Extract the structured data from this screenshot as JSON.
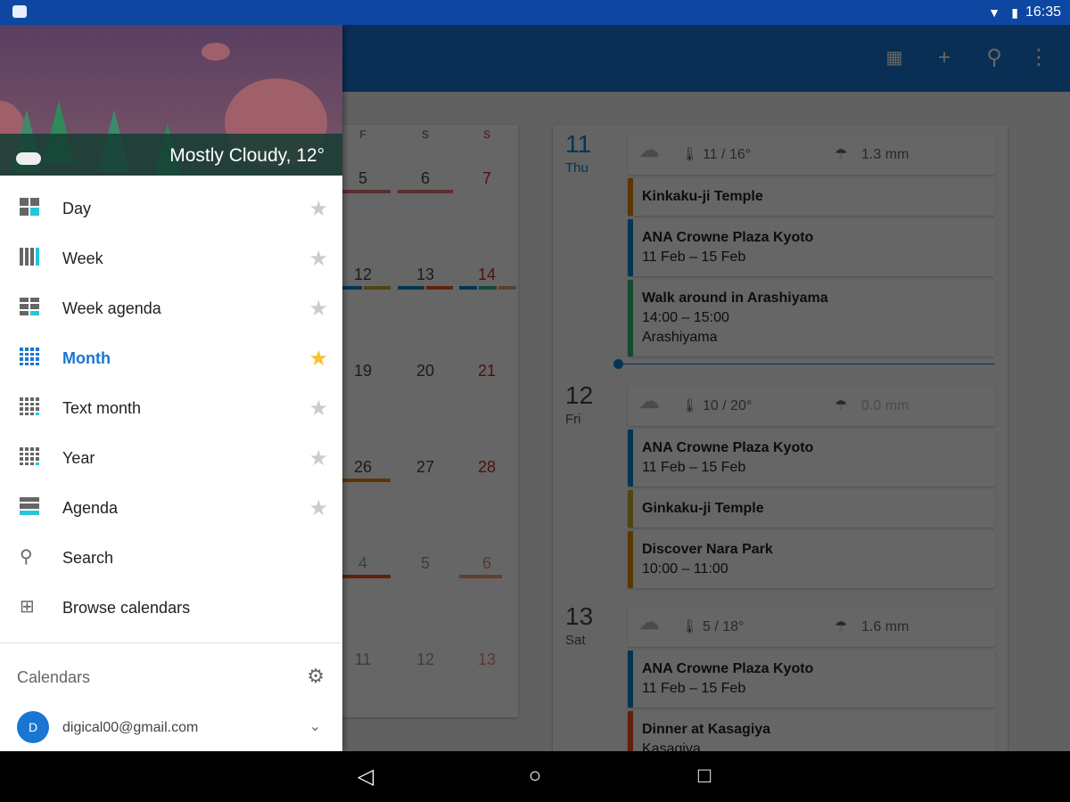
{
  "status": {
    "time": "16:35",
    "icons": [
      "android-icon",
      "wifi-icon",
      "battery-charging-icon"
    ]
  },
  "appbar": {
    "actions": [
      "today-calendar-icon",
      "add-icon",
      "search-icon",
      "more-vert-icon"
    ]
  },
  "month": {
    "headers": [
      "F",
      "S",
      "S"
    ],
    "rows": [
      [
        "5",
        "6",
        "7"
      ],
      [
        "12",
        "13",
        "14"
      ],
      [
        "19",
        "20",
        "21"
      ],
      [
        "26",
        "27",
        "28"
      ],
      [
        "4",
        "5",
        "6"
      ],
      [
        "11",
        "12",
        "13"
      ]
    ]
  },
  "agenda": {
    "days": [
      {
        "num": "11",
        "name": "Thu",
        "today": true,
        "weather": {
          "icon": "rain-icon",
          "temp": "11 / 16°",
          "precip": "1.3 mm"
        },
        "events": [
          {
            "title": "Kinkaku-ji Temple",
            "lines": [],
            "color": "#e08a00"
          },
          {
            "title": "ANA Crowne Plaza Kyoto",
            "lines": [
              "11 Feb – 15 Feb"
            ],
            "color": "#0288d1"
          },
          {
            "title": "Walk around in Arashiyama",
            "lines": [
              "14:00 – 15:00",
              "Arashiyama"
            ],
            "color": "#33b679"
          }
        ]
      },
      {
        "num": "12",
        "name": "Fri",
        "today": false,
        "weather": {
          "icon": "partly-cloudy-icon",
          "temp": "10 / 20°",
          "precip": "0.0 mm"
        },
        "events": [
          {
            "title": "ANA Crowne Plaza Kyoto",
            "lines": [
              "11 Feb – 15 Feb"
            ],
            "color": "#0288d1"
          },
          {
            "title": "Ginkaku-ji Temple",
            "lines": [],
            "color": "#c0b030"
          },
          {
            "title": "Discover Nara Park",
            "lines": [
              "10:00 – 11:00"
            ],
            "color": "#e08a00"
          }
        ]
      },
      {
        "num": "13",
        "name": "Sat",
        "today": false,
        "weather": {
          "icon": "cloudy-icon",
          "temp": "5 / 18°",
          "precip": "1.6 mm"
        },
        "events": [
          {
            "title": "ANA Crowne Plaza Kyoto",
            "lines": [
              "11 Feb – 15 Feb"
            ],
            "color": "#0288d1"
          },
          {
            "title": "Dinner at Kasagiya",
            "lines": [
              "Kasagiya"
            ],
            "color": "#f4511e"
          }
        ]
      }
    ]
  },
  "drawer": {
    "weather": "Mostly Cloudy, 12°",
    "items": [
      {
        "label": "Day",
        "icon": "day-view-icon",
        "star": true
      },
      {
        "label": "Week",
        "icon": "week-view-icon",
        "star": true
      },
      {
        "label": "Week agenda",
        "icon": "week-agenda-icon",
        "star": true
      },
      {
        "label": "Month",
        "icon": "month-view-icon",
        "star": true,
        "selected": true
      },
      {
        "label": "Text month",
        "icon": "text-month-icon",
        "star": true
      },
      {
        "label": "Year",
        "icon": "year-view-icon",
        "star": true
      },
      {
        "label": "Agenda",
        "icon": "agenda-view-icon",
        "star": true
      },
      {
        "label": "Search",
        "icon": "search-icon",
        "star": false
      },
      {
        "label": "Browse calendars",
        "icon": "calendar-add-icon",
        "star": false
      }
    ],
    "calendars_header": "Calendars",
    "account": "digical00@gmail.com"
  },
  "colors": {
    "accent": "#1976d2",
    "status_bar": "#0d47a1",
    "star_selected": "#fbc02d",
    "today": "#0288d1"
  }
}
